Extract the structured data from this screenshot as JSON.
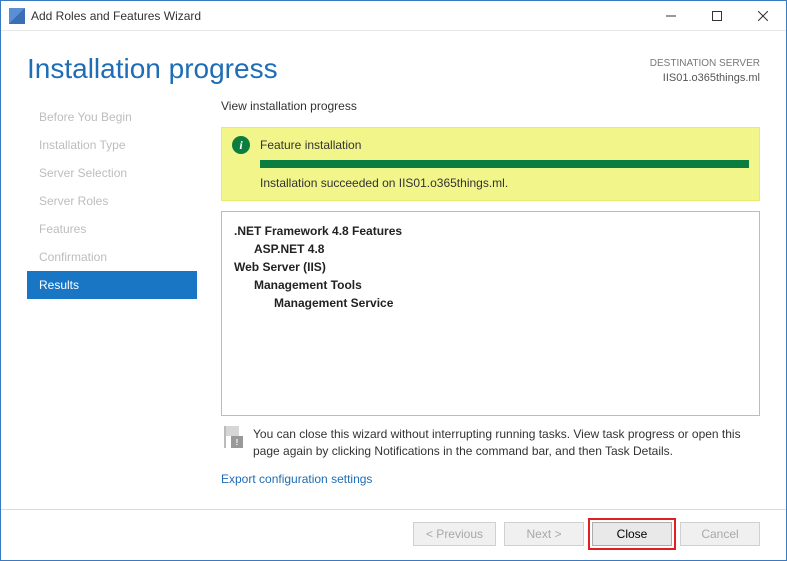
{
  "titlebar": {
    "title": "Add Roles and Features Wizard"
  },
  "header": {
    "page_title": "Installation progress",
    "dest_label": "DESTINATION SERVER",
    "dest_value": "IIS01.o365things.ml"
  },
  "sidebar": {
    "items": [
      {
        "label": "Before You Begin",
        "active": false
      },
      {
        "label": "Installation Type",
        "active": false
      },
      {
        "label": "Server Selection",
        "active": false
      },
      {
        "label": "Server Roles",
        "active": false
      },
      {
        "label": "Features",
        "active": false
      },
      {
        "label": "Confirmation",
        "active": false
      },
      {
        "label": "Results",
        "active": true
      }
    ]
  },
  "main": {
    "subheading": "View installation progress",
    "banner": {
      "title": "Feature installation",
      "message": "Installation succeeded on IIS01.o365things.ml."
    },
    "features_tree": [
      {
        "text": ".NET Framework 4.8 Features",
        "bold": true,
        "indent": 0
      },
      {
        "text": "ASP.NET 4.8",
        "bold": true,
        "indent": 1
      },
      {
        "text": "Web Server (IIS)",
        "bold": true,
        "indent": 0
      },
      {
        "text": "Management Tools",
        "bold": true,
        "indent": 1
      },
      {
        "text": "Management Service",
        "bold": true,
        "indent": 2
      }
    ],
    "notice": "You can close this wizard without interrupting running tasks. View task progress or open this page again by clicking Notifications in the command bar, and then Task Details.",
    "export_link": "Export configuration settings"
  },
  "buttons": {
    "previous": "< Previous",
    "next": "Next >",
    "close": "Close",
    "cancel": "Cancel"
  }
}
